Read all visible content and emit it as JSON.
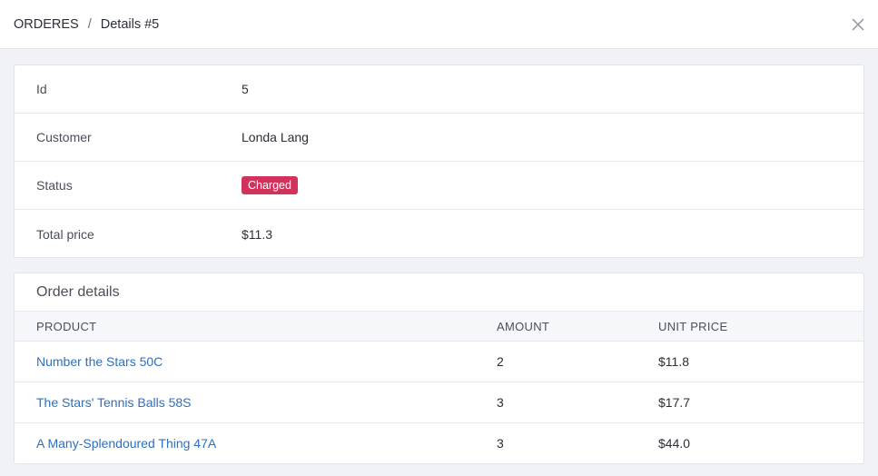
{
  "breadcrumb": {
    "root": "ORDERES",
    "separator": "/",
    "current": "Details #5"
  },
  "close_icon": "close-icon",
  "info": {
    "id": {
      "label": "Id",
      "value": "5"
    },
    "customer": {
      "label": "Customer",
      "value": "Londa Lang"
    },
    "status": {
      "label": "Status",
      "value": "Charged",
      "color": "#d2335c"
    },
    "total": {
      "label": "Total price",
      "value": "$11.3"
    }
  },
  "order_details": {
    "title": "Order details",
    "columns": [
      "PRODUCT",
      "AMOUNT",
      "UNIT PRICE"
    ],
    "rows": [
      {
        "product": "Number the Stars 50C",
        "amount": "2",
        "unit_price": "$11.8"
      },
      {
        "product": "The Stars' Tennis Balls 58S",
        "amount": "3",
        "unit_price": "$17.7"
      },
      {
        "product": "A Many-Splendoured Thing 47A",
        "amount": "3",
        "unit_price": "$44.0"
      }
    ]
  },
  "colors": {
    "link": "#2f6fbd",
    "badge": "#d2335c",
    "background": "#f0f2f7"
  }
}
